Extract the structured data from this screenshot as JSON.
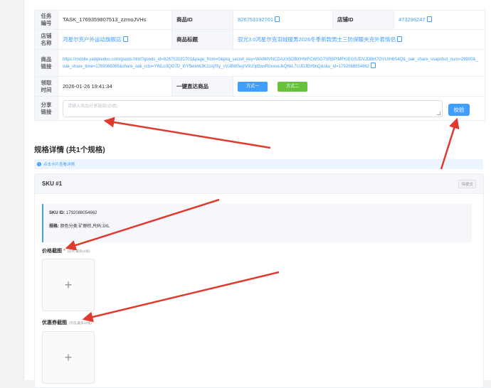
{
  "info_table": {
    "task_label": "任务\n编号",
    "task_value": "TASK_1769359807513_zzmoJVHs",
    "product_id_label": "商品ID",
    "product_id_value": "826753192701",
    "shop_id_label": "店铺ID",
    "shop_id_value": "473296247",
    "shop_name_label": "店铺\n名称",
    "shop_name_value": "鸿星尔克户外运动旗舰店",
    "product_title_label": "商品标题",
    "product_title_value": "驭光3.0鸿星尔克羽绒服男2026冬季新款男士三防保暖夹克外套情侣",
    "product_link_label": "商品\n链接",
    "product_link_value": "https://mobile.yangkeduo.com/goods.html?goods_id=826753192701&page_from=0&pxq_secret_key=WA8MVNCDAXX5DBXHWFCWSG7SR5PIMFKIEGSJDVJDBH7OVUIH6S4Q&_oak_share_snapshot_num=29900&_oak_share_time=1769066085&share_oak_rcto=YWLo3QO7D_t0Y5emWJK2zAjfSy_vVsBWSejrV0U0p5wxR0xxveJkQ6kL7UJDJEH9nQ&sku_id=1792088054662",
    "claim_time_label": "领取\n时间",
    "claim_time_value": "2026-01-26 19:41:34",
    "one_click_label": "一键直达商品",
    "method1": "方式一",
    "method2": "方式二",
    "share_label": "分享\n链接",
    "share_placeholder": "请输入商品分享链接(必填)",
    "verify_button": "校验"
  },
  "spec": {
    "title": "规格详情 (共1个规格)",
    "tip": "点击卡片查看详情",
    "sku_title": "SKU #1",
    "sku_status": "待提交",
    "sku_id_label": "SKU ID:",
    "sku_id_value": "1792088054662",
    "spec_label": "规格:",
    "spec_value": "颜色分类:矿野棕,尺码:3XL",
    "price_label": "价格截图",
    "price_required": "*",
    "price_hint": "(必传,最多10张)",
    "coupon_label": "优惠券截图",
    "coupon_hint": "(可选,最多10张)",
    "upload_plus": "+"
  },
  "colors": {
    "accent": "#409eff",
    "green": "#67c23a",
    "annotation_red": "#e03a2f"
  }
}
